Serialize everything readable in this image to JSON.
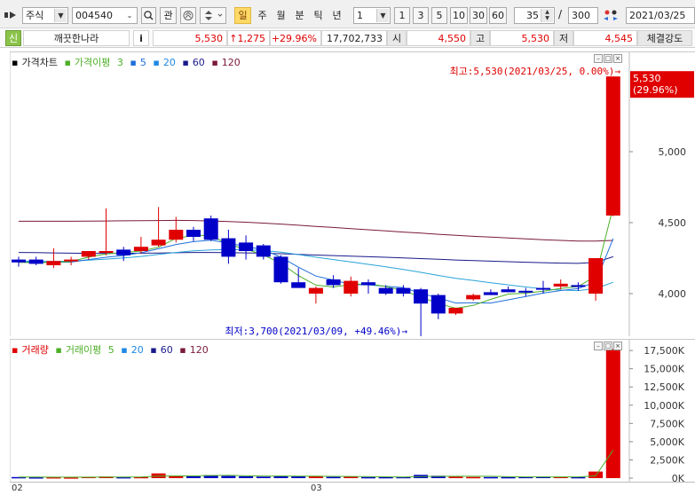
{
  "toolbar": {
    "market": "주식",
    "code": "004540",
    "search_icon": "search-icon",
    "interest_label": "관",
    "periods": [
      "일",
      "주",
      "월",
      "분",
      "틱",
      "년"
    ],
    "active_period": "일",
    "interval_value": "1",
    "interval_buttons": [
      "1",
      "3",
      "5",
      "10",
      "30",
      "60"
    ],
    "view_count": "35",
    "total_count": "300",
    "date": "2021/03/25"
  },
  "quote": {
    "badge": "신",
    "name": "깨끗한나라",
    "info": "i",
    "price": "5,530",
    "change": "↑1,275",
    "change_rate": "+29.96%",
    "volume": "17,702,733",
    "open_label": "시",
    "open": "4,550",
    "high_label": "고",
    "high": "5,530",
    "low_label": "저",
    "low": "4,545",
    "strength_label": "체결강도",
    "up_color": "#e00000",
    "down_color": "#0000c8"
  },
  "price_legend": {
    "chart_label": "가격차트",
    "ma_label": "가격이평",
    "ma_periods": [
      "3",
      "5",
      "20",
      "60",
      "120"
    ],
    "ma_colors": [
      "#4caf26",
      "#1e6fd9",
      "#1e88e5",
      "#1a1a8c",
      "#7a1a3a"
    ]
  },
  "volume_legend": {
    "chart_label": "거래량",
    "ma_label": "거래이평",
    "ma_periods": [
      "5",
      "20",
      "60",
      "120"
    ]
  },
  "annotations": {
    "high": "최고:5,530(2021/03/25, 0.00%)→",
    "low": "최저:3,700(2021/03/09, +49.46%)→",
    "last_price": "5,530",
    "last_rate": "(29.96%)"
  },
  "dates": [
    "02",
    "03"
  ],
  "chart_data": [
    {
      "type": "candlestick",
      "title": "가격차트",
      "ylim": [
        3700,
        5700
      ],
      "y_ticks": [
        "4,000",
        "4,500",
        "5,000"
      ],
      "candles": [
        {
          "o": 4240,
          "h": 4260,
          "l": 4190,
          "c": 4220
        },
        {
          "o": 4240,
          "h": 4260,
          "l": 4200,
          "c": 4210
        },
        {
          "o": 4200,
          "h": 4320,
          "l": 4180,
          "c": 4230
        },
        {
          "o": 4230,
          "h": 4260,
          "l": 4200,
          "c": 4240
        },
        {
          "o": 4260,
          "h": 4300,
          "l": 4240,
          "c": 4300
        },
        {
          "o": 4290,
          "h": 4600,
          "l": 4270,
          "c": 4300
        },
        {
          "o": 4310,
          "h": 4330,
          "l": 4230,
          "c": 4270
        },
        {
          "o": 4300,
          "h": 4400,
          "l": 4280,
          "c": 4330
        },
        {
          "o": 4340,
          "h": 4610,
          "l": 4330,
          "c": 4380
        },
        {
          "o": 4380,
          "h": 4540,
          "l": 4360,
          "c": 4450
        },
        {
          "o": 4450,
          "h": 4470,
          "l": 4370,
          "c": 4400
        },
        {
          "o": 4530,
          "h": 4550,
          "l": 4370,
          "c": 4380
        },
        {
          "o": 4390,
          "h": 4450,
          "l": 4210,
          "c": 4260
        },
        {
          "o": 4360,
          "h": 4410,
          "l": 4240,
          "c": 4300
        },
        {
          "o": 4340,
          "h": 4350,
          "l": 4240,
          "c": 4260
        },
        {
          "o": 4260,
          "h": 4270,
          "l": 4070,
          "c": 4080
        },
        {
          "o": 4080,
          "h": 4180,
          "l": 4040,
          "c": 4040
        },
        {
          "o": 4000,
          "h": 4050,
          "l": 3930,
          "c": 4040
        },
        {
          "o": 4100,
          "h": 4130,
          "l": 4040,
          "c": 4060
        },
        {
          "o": 4000,
          "h": 4120,
          "l": 3980,
          "c": 4090
        },
        {
          "o": 4080,
          "h": 4100,
          "l": 4000,
          "c": 4060
        },
        {
          "o": 4040,
          "h": 4060,
          "l": 3990,
          "c": 4000
        },
        {
          "o": 4040,
          "h": 4060,
          "l": 3980,
          "c": 4000
        },
        {
          "o": 4030,
          "h": 4040,
          "l": 3700,
          "c": 3930
        },
        {
          "o": 3990,
          "h": 4000,
          "l": 3820,
          "c": 3860
        },
        {
          "o": 3860,
          "h": 3900,
          "l": 3850,
          "c": 3900
        },
        {
          "o": 3960,
          "h": 4000,
          "l": 3950,
          "c": 3990
        },
        {
          "o": 4010,
          "h": 4030,
          "l": 3990,
          "c": 3990
        },
        {
          "o": 4030,
          "h": 4050,
          "l": 4010,
          "c": 4010
        },
        {
          "o": 4020,
          "h": 4040,
          "l": 3980,
          "c": 4010
        },
        {
          "o": 4040,
          "h": 4090,
          "l": 4000,
          "c": 4030
        },
        {
          "o": 4050,
          "h": 4100,
          "l": 4030,
          "c": 4070
        },
        {
          "o": 4060,
          "h": 4080,
          "l": 4020,
          "c": 4050
        },
        {
          "o": 4000,
          "h": 4050,
          "l": 3950,
          "c": 4250
        },
        {
          "o": 4550,
          "h": 5530,
          "l": 4545,
          "c": 5530
        }
      ],
      "ma": {
        "3": [
          4220,
          4218,
          4220,
          4227,
          4257,
          4280,
          4290,
          4300,
          4327,
          4390,
          4410,
          4410,
          4347,
          4313,
          4273,
          4213,
          4127,
          4060,
          4047,
          4063,
          4070,
          4050,
          4020,
          3977,
          3930,
          3897,
          3917,
          3960,
          3997,
          4003,
          4017,
          4037,
          4050,
          4123,
          4610
        ],
        "5": [
          4225,
          4222,
          4220,
          4222,
          4240,
          4256,
          4268,
          4288,
          4316,
          4346,
          4366,
          4376,
          4356,
          4332,
          4310,
          4256,
          4186,
          4124,
          4096,
          4064,
          4062,
          4052,
          4042,
          4002,
          3970,
          3934,
          3936,
          3934,
          3956,
          3980,
          4004,
          4022,
          4036,
          4082,
          4388
        ],
        "20": [
          4230,
          4228,
          4227,
          4230,
          4236,
          4243,
          4251,
          4262,
          4276,
          4290,
          4302,
          4308,
          4310,
          4309,
          4304,
          4292,
          4275,
          4257,
          4240,
          4223,
          4206,
          4189,
          4170,
          4150,
          4128,
          4108,
          4093,
          4077,
          4062,
          4047,
          4034,
          4025,
          4021,
          4036,
          4080
        ],
        "60": [
          4290,
          4289,
          4287,
          4285,
          4284,
          4284,
          4284,
          4285,
          4286,
          4288,
          4290,
          4290,
          4289,
          4287,
          4285,
          4281,
          4277,
          4272,
          4268,
          4264,
          4260,
          4256,
          4252,
          4247,
          4242,
          4237,
          4233,
          4229,
          4225,
          4221,
          4218,
          4215,
          4213,
          4220,
          4260
        ],
        "120": [
          4510,
          4510,
          4510,
          4510,
          4511,
          4512,
          4513,
          4514,
          4515,
          4516,
          4515,
          4512,
          4508,
          4503,
          4497,
          4490,
          4482,
          4474,
          4466,
          4458,
          4450,
          4442,
          4434,
          4426,
          4418,
          4411,
          4404,
          4398,
          4392,
          4386,
          4380,
          4375,
          4370,
          4370,
          4375
        ]
      }
    },
    {
      "type": "bar",
      "title": "거래량",
      "ylim": [
        0,
        18000
      ],
      "y_ticks": [
        "0K",
        "2,500K",
        "5,000K",
        "7,500K",
        "10,000K",
        "12,500K",
        "15,000K",
        "17,500K"
      ],
      "values": [
        150,
        120,
        130,
        110,
        180,
        220,
        140,
        160,
        650,
        350,
        250,
        420,
        300,
        260,
        200,
        320,
        280,
        260,
        170,
        190,
        150,
        150,
        160,
        450,
        330,
        200,
        160,
        150,
        150,
        170,
        210,
        180,
        150,
        900,
        17700
      ],
      "ma5": [
        150,
        140,
        135,
        130,
        138,
        152,
        156,
        168,
        270,
        306,
        310,
        366,
        394,
        316,
        286,
        290,
        272,
        264,
        246,
        232,
        208,
        184,
        164,
        220,
        248,
        258,
        260,
        258,
        198,
        166,
        168,
        172,
        172,
        318,
        3830
      ]
    }
  ]
}
